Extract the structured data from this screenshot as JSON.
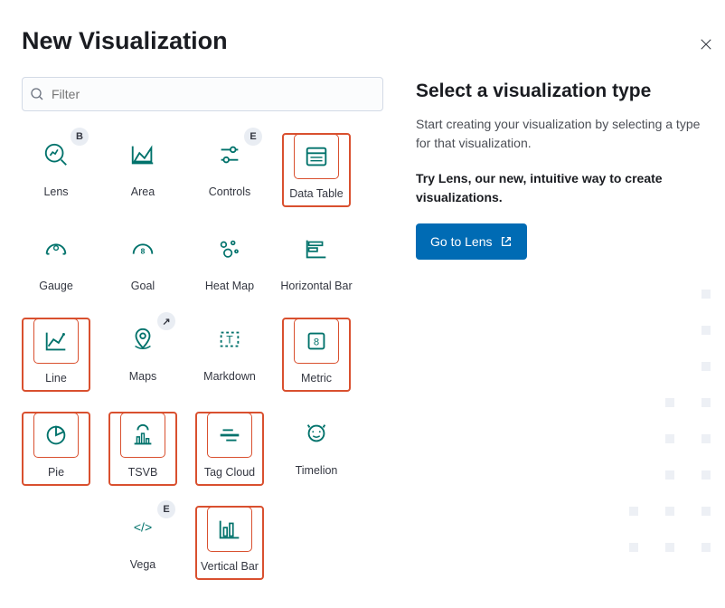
{
  "title": "New Visualization",
  "filter": {
    "placeholder": "Filter"
  },
  "tiles": {
    "lens": "Lens",
    "area": "Area",
    "controls": "Controls",
    "datatable": "Data Table",
    "gauge": "Gauge",
    "goal": "Goal",
    "heatmap": "Heat Map",
    "hbar": "Horizontal Bar",
    "line": "Line",
    "maps": "Maps",
    "markdown": "Markdown",
    "metric": "Metric",
    "pie": "Pie",
    "tsvb": "TSVB",
    "tagcloud": "Tag Cloud",
    "timelion": "Timelion",
    "vega": "Vega",
    "vbar": "Vertical Bar"
  },
  "badges": {
    "lens": "B",
    "controls": "E",
    "maps": "↗",
    "vega": "E"
  },
  "side": {
    "heading": "Select a visualization type",
    "desc": "Start creating your visualization by selecting a type for that visualization.",
    "promo": "Try Lens, our new, intuitive way to create visualizations.",
    "cta": "Go to Lens"
  },
  "colors": {
    "accent": "#006bb4",
    "teal": "#00726b",
    "highlight": "#d9502f"
  }
}
